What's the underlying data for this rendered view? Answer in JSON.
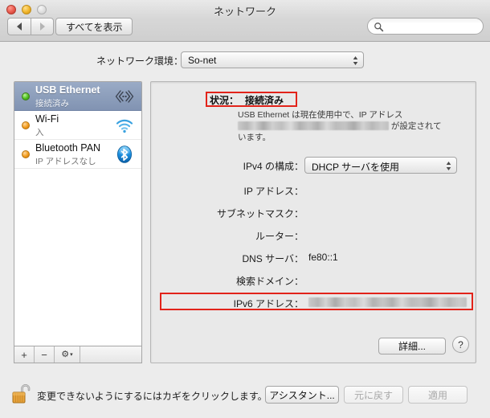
{
  "window": {
    "title": "ネットワーク",
    "traffic_lights": [
      "close-button",
      "minimize-button",
      "zoom-button"
    ]
  },
  "toolbar": {
    "back_icon": "triangle-left-icon",
    "forward_icon": "triangle-right-icon",
    "show_all_label": "すべてを表示",
    "search_placeholder": "",
    "search_value": "",
    "search_icon": "search-icon"
  },
  "location": {
    "label": "ネットワーク環境：",
    "value": "So-net",
    "options": [
      "So-net"
    ]
  },
  "sidebar": {
    "services": [
      {
        "name": "USB Ethernet",
        "status": "接続済み",
        "dot": "green",
        "icon": "ethernet-icon",
        "selected": true
      },
      {
        "name": "Wi-Fi",
        "status": "入",
        "dot": "orange",
        "icon": "wifi-icon",
        "selected": false
      },
      {
        "name": "Bluetooth PAN",
        "status": "IP アドレスなし",
        "dot": "orange",
        "icon": "bluetooth-icon",
        "selected": false
      }
    ],
    "toolbar": {
      "add_label": "+",
      "remove_label": "−",
      "gear_label": "⚙",
      "gear_caret": "▾"
    }
  },
  "detail": {
    "status": {
      "label": "状況：",
      "value": "接続済み",
      "highlight_color": "#e2231a",
      "description_before": "USB Ethernet は現在使用中で、IP アドレス",
      "description_redacted": "[非表示の IP アドレス]",
      "description_after": "が設定されて",
      "description_end": "います。"
    },
    "fields": [
      {
        "label": "IPv4 の構成：",
        "value": "DHCP サーバを使用",
        "type": "popup"
      },
      {
        "label": "IP アドレス：",
        "value": "",
        "type": "text"
      },
      {
        "label": "サブネットマスク：",
        "value": "",
        "type": "text"
      },
      {
        "label": "ルーター：",
        "value": "",
        "type": "text"
      },
      {
        "label": "DNS サーバ：",
        "value": "fe80::1",
        "type": "text"
      },
      {
        "label": "検索ドメイン：",
        "value": "",
        "type": "text"
      },
      {
        "label": "IPv6 アドレス：",
        "value": "[非表示の IPv6 アドレス]",
        "type": "redacted"
      }
    ],
    "advanced_label": "詳細...",
    "help_label": "?"
  },
  "bottom": {
    "lock_icon": "unlocked-padlock-icon",
    "lock_text": "変更できないようにするにはカギをクリックします。",
    "assistant_label": "アシスタント...",
    "revert_label": "元に戻す",
    "apply_label": "適用"
  }
}
